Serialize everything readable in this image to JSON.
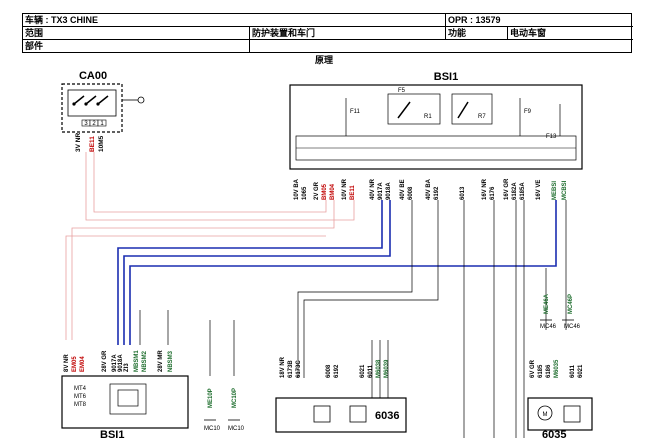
{
  "header": {
    "vehicle_label": "车辆 : TX3 CHINE",
    "opr_label": "OPR : 13579",
    "scope_label": "范围",
    "scope_value": "防护装置和车门",
    "function_label": "功能",
    "function_value": "电动车窗",
    "part_label": "部件"
  },
  "subtitle": "原理",
  "components": {
    "ca00": "CA00",
    "bsi1": "BSI1",
    "bsi1_fuses": {
      "f11": "F11",
      "f5": "F5",
      "r1": "R1",
      "r7": "R7",
      "f9": "F9",
      "f13": "F13"
    },
    "c6036": "6036",
    "c6035": "6035",
    "bsi_bottom": "BSI1",
    "ca00_pins": [
      "3",
      "2",
      "1"
    ]
  },
  "wires": {
    "ca00_wire": [
      "3V NR",
      "BE11",
      "10M5"
    ],
    "bsi_groups": [
      [
        "10V BA",
        "1065",
        "1"
      ],
      [
        "2V GR",
        "BM05",
        "BM04",
        "2",
        "3"
      ],
      [
        "10V NR",
        "BE11",
        "7"
      ],
      [
        "40V NR",
        "9017A",
        "9018A",
        "37",
        "38"
      ],
      [
        "40V BE",
        "6008",
        "39"
      ],
      [
        "40V BA",
        "6192",
        "6"
      ],
      [
        "6013",
        "12"
      ],
      [
        "16V NR",
        "6176",
        "7"
      ],
      [
        "16V GR",
        "6182A",
        "6185A",
        "8",
        "9"
      ],
      [
        "16V VE",
        "ZI3",
        "16"
      ],
      [
        "MEBSI",
        "MCBSI"
      ]
    ],
    "ground_labels": [
      "ME46A",
      "MC46P",
      "MC46",
      "MC46"
    ],
    "left_connector": [
      "8V NR",
      "EM05",
      "EM04",
      "28V GR",
      "9017A",
      "9018A",
      "ZI3",
      "MBSM1",
      "NBSM2",
      "28V MR",
      "NBSM3"
    ],
    "left_connector_pins": [
      "5",
      "6",
      "11",
      "12",
      "13",
      "14",
      "15",
      "7",
      "8"
    ],
    "left_grounds": [
      "ME10P",
      "MC10P",
      "MC10",
      "MC10"
    ],
    "c6036_wires": [
      "18V NR",
      "6173B",
      "6173C",
      "6008",
      "6192",
      "6021",
      "6011",
      "M6038",
      "M6039"
    ],
    "c6035_wires": [
      "6V GR",
      "6185",
      "6186",
      "M6035",
      "6011",
      "6021"
    ],
    "internal_labels": [
      "MT4",
      "MT6",
      "MT8"
    ]
  }
}
